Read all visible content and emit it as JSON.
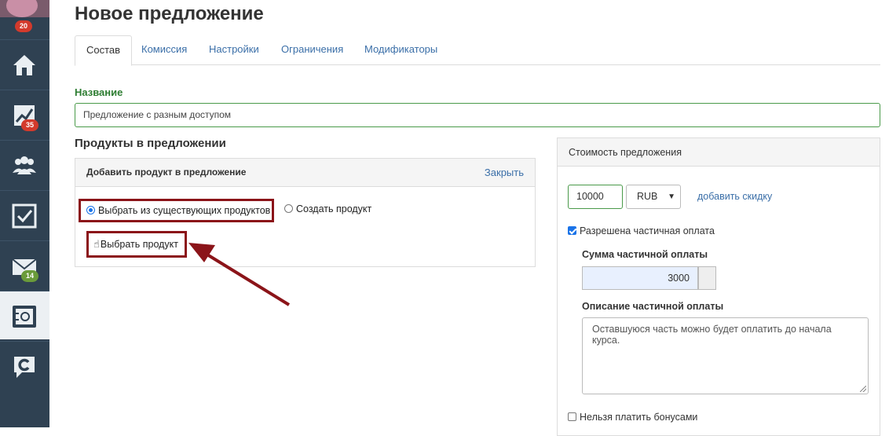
{
  "sidebar": {
    "badges": {
      "top": "20",
      "stats": "35",
      "mail": "14"
    },
    "items": [
      {
        "icon": "home-icon"
      },
      {
        "icon": "chart-icon"
      },
      {
        "icon": "users-icon"
      },
      {
        "icon": "tasks-icon"
      },
      {
        "icon": "mail-icon"
      },
      {
        "icon": "safe-icon",
        "active": true
      },
      {
        "icon": "chat-icon"
      }
    ]
  },
  "page": {
    "title": "Новое предложение"
  },
  "tabs": [
    {
      "label": "Состав",
      "active": true
    },
    {
      "label": "Комиссия"
    },
    {
      "label": "Настройки"
    },
    {
      "label": "Ограничения"
    },
    {
      "label": "Модификаторы"
    }
  ],
  "name": {
    "label": "Название",
    "value": "Предложение с разным доступом"
  },
  "products": {
    "heading": "Продукты в предложении",
    "panel_title": "Добавить продукт в предложение",
    "close_label": "Закрыть",
    "option_existing": "Выбрать из существующих продуктов",
    "option_create": "Создать продукт",
    "pick_button": "Выбрать продукт"
  },
  "cost": {
    "heading": "Стоимость предложения",
    "price": "10000",
    "currency": "RUB",
    "add_discount": "добавить скидку",
    "partial_allowed": "Разрешена частичная оплата",
    "partial_sum_label": "Сумма частичной оплаты",
    "partial_sum": "3000",
    "partial_desc_label": "Описание частичной оплаты",
    "partial_desc": "Оставшуюся часть можно будет оплатить до начала курса.",
    "no_bonus": "Нельзя платить бонусами"
  },
  "colors": {
    "sidebar": "#2f4152",
    "highlight": "#8b1419",
    "link": "#3b6fa8",
    "name_label": "#2e7d32"
  }
}
